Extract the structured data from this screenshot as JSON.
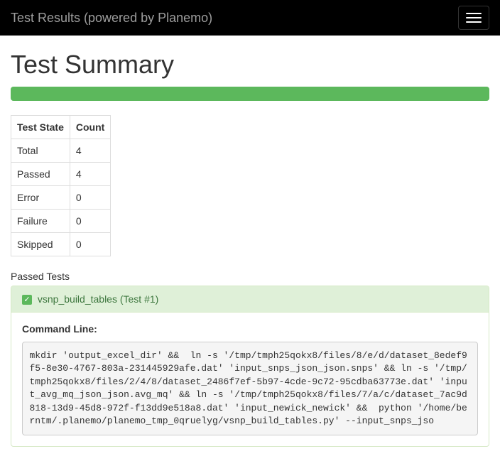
{
  "navbar": {
    "brand": "Test Results (powered by Planemo)"
  },
  "title": "Test Summary",
  "summary": {
    "headers": {
      "state": "Test State",
      "count": "Count"
    },
    "rows": [
      {
        "state": "Total",
        "count": "4"
      },
      {
        "state": "Passed",
        "count": "4"
      },
      {
        "state": "Error",
        "count": "0"
      },
      {
        "state": "Failure",
        "count": "0"
      },
      {
        "state": "Skipped",
        "count": "0"
      }
    ]
  },
  "passedSection": "Passed Tests",
  "test": {
    "title": "vsnp_build_tables (Test #1)",
    "cmdLabel": "Command Line:",
    "cmd": "mkdir 'output_excel_dir' &&  ln -s '/tmp/tmph25qokx8/files/8/e/d/dataset_8edef9f5-8e30-4767-803a-231445929afe.dat' 'input_snps_json_json.snps' && ln -s '/tmp/tmph25qokx8/files/2/4/8/dataset_2486f7ef-5b97-4cde-9c72-95cdba63773e.dat' 'input_avg_mq_json_json.avg_mq' && ln -s '/tmp/tmph25qokx8/files/7/a/c/dataset_7ac9d818-13d9-45d8-972f-f13dd9e518a8.dat' 'input_newick_newick' &&  python '/home/berntm/.planemo/planemo_tmp_0qruelyg/vsnp_build_tables.py' --input_snps_jso"
  }
}
